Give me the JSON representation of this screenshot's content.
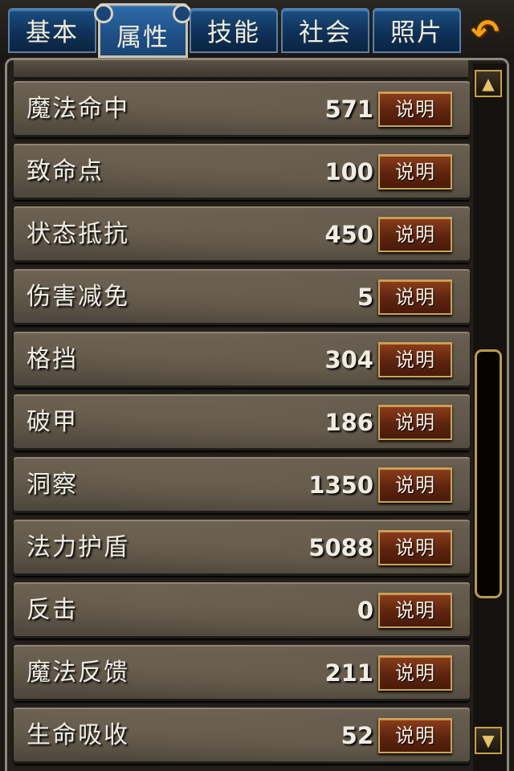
{
  "tabs": [
    {
      "label": "基本"
    },
    {
      "label": "属性"
    },
    {
      "label": "技能"
    },
    {
      "label": "社会"
    },
    {
      "label": "照片"
    }
  ],
  "active_tab": "属性",
  "back_icon": "back-arrow-icon",
  "stats": [
    {
      "label": "魔法命中",
      "value": "571",
      "button": "说明"
    },
    {
      "label": "致命点",
      "value": "100",
      "button": "说明"
    },
    {
      "label": "状态抵抗",
      "value": "450",
      "button": "说明"
    },
    {
      "label": "伤害减免",
      "value": "5",
      "button": "说明"
    },
    {
      "label": "格挡",
      "value": "304",
      "button": "说明"
    },
    {
      "label": "破甲",
      "value": "186",
      "button": "说明"
    },
    {
      "label": "洞察",
      "value": "1350",
      "button": "说明"
    },
    {
      "label": "法力护盾",
      "value": "5088",
      "button": "说明"
    },
    {
      "label": "反击",
      "value": "0",
      "button": "说明"
    },
    {
      "label": "魔法反馈",
      "value": "211",
      "button": "说明"
    },
    {
      "label": "生命吸收",
      "value": "52",
      "button": "说明"
    }
  ],
  "colors": {
    "tab_blue": "#0f3159",
    "button_brown": "#5e2410",
    "gold_border": "#c9a45a",
    "back_arrow": "#f3a014"
  }
}
